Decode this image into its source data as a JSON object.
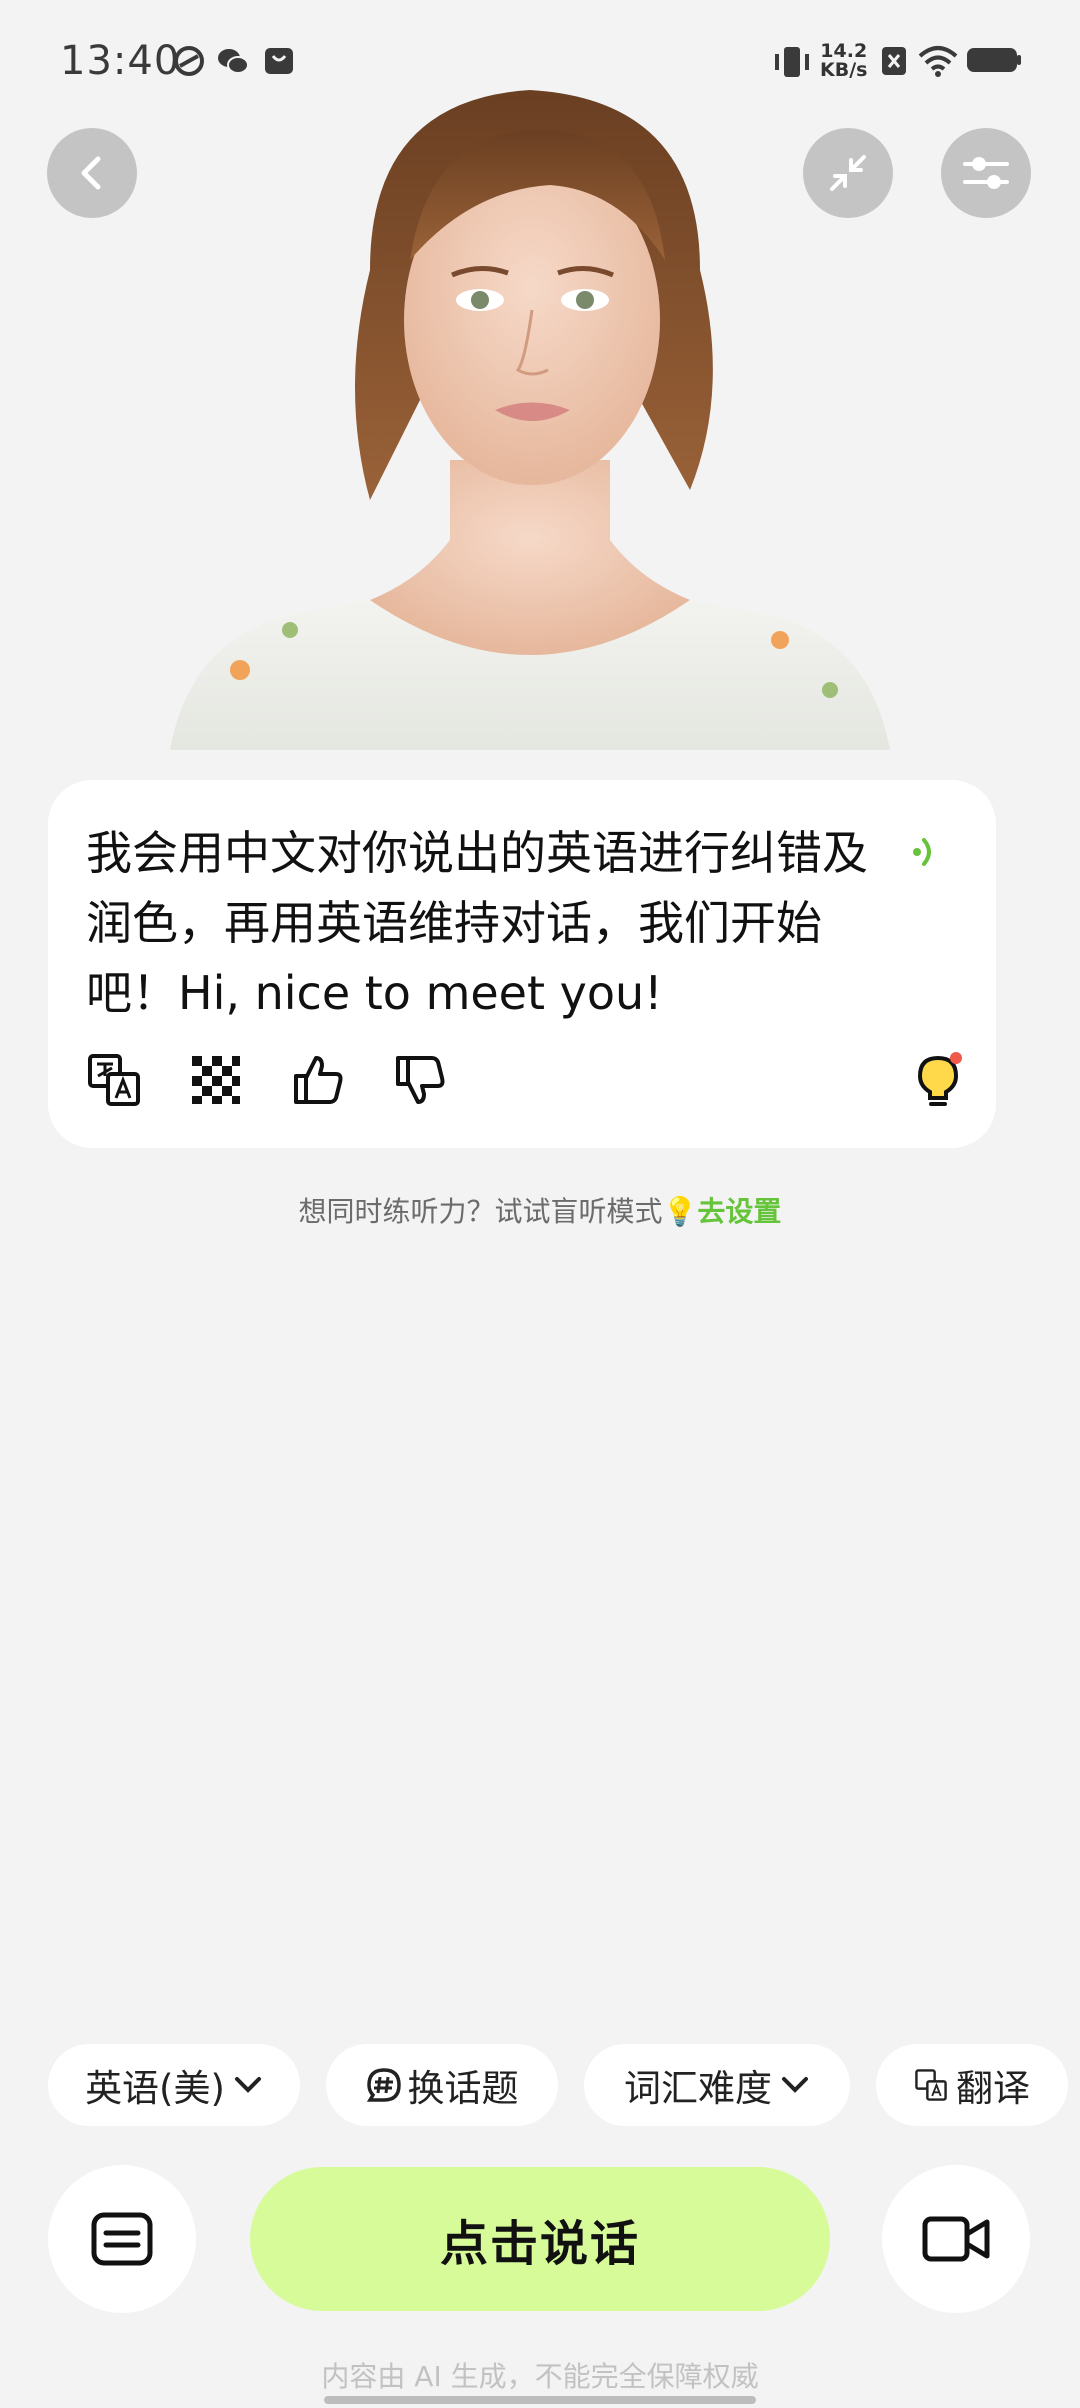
{
  "status_bar": {
    "time": "13:40",
    "network_speed_value": "14.2",
    "network_speed_unit": "KB/s",
    "icons": [
      "camera-lens-icon",
      "wechat-icon",
      "shopping-bag-icon",
      "vibrate-icon",
      "sim-x-icon",
      "wifi-icon",
      "battery-icon"
    ]
  },
  "header": {
    "back_icon": "chevron-left-icon",
    "minimize_icon": "collapse-arrows-icon",
    "settings_icon": "sliders-icon"
  },
  "message": {
    "text": "我会用中文对你说出的英语进行纠错及润色，再用英语维持对话，我们开始吧！Hi, nice to meet you!",
    "speaker_icon": "sound-wave-icon",
    "actions": [
      "translate-icon",
      "mosaic-icon",
      "thumbs-up-icon",
      "thumbs-down-icon",
      "lightbulb-icon"
    ]
  },
  "hint": {
    "text": "想同时练听力？试试盲听模式💡",
    "link": "去设置"
  },
  "chips": {
    "language": "英语(美)",
    "change_topic": "换话题",
    "vocab_level": "词汇难度",
    "translate": "翻译"
  },
  "bottom": {
    "speak_label": "点击说话",
    "keyboard_icon": "keyboard-icon",
    "video_icon": "video-camera-icon"
  },
  "disclaimer": "内容由 AI 生成，不能完全保障权威",
  "colors": {
    "accent_green": "#66c43a",
    "speak_button_bg": "#d6fb98",
    "page_bg": "#f3f3f3"
  }
}
